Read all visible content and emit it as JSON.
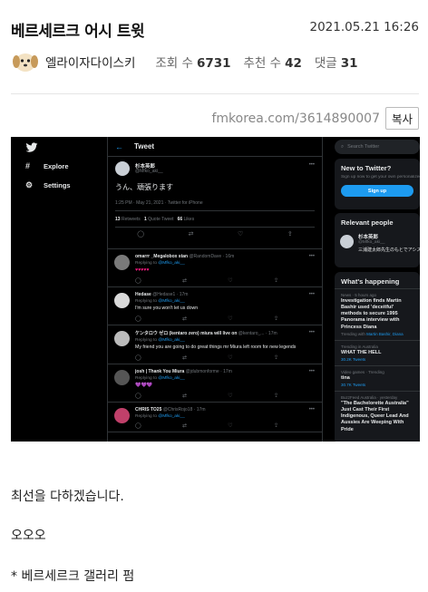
{
  "post": {
    "title": "베르세르크 어시 트윗",
    "date": "2021.05.21 16:26",
    "author": "엘라이자다이스키",
    "stats": [
      {
        "label": "조회 수",
        "value": "6731"
      },
      {
        "label": "추천 수",
        "value": "42"
      },
      {
        "label": "댓글",
        "value": "31"
      }
    ],
    "link": "fmkorea.com/3614890007",
    "copy_label": "복사",
    "body": [
      "최선을 다하겠습니다.",
      "오오오",
      "* 베르세르크 갤러리 펌"
    ]
  },
  "twitter": {
    "nav": {
      "explore": "Explore",
      "settings": "Settings"
    },
    "header": "Tweet",
    "tweet": {
      "name": "杉本英郎",
      "handle": "@Mfko_aki__",
      "text": "うん、頑張ります",
      "meta": "1:25 PM · May 21, 2021 · Twitter for iPhone",
      "retweets": "13",
      "retweets_label": "Retweets",
      "quotes": "1",
      "quotes_label": "Quote Tweet",
      "likes": "66",
      "likes_label": "Likes"
    },
    "replies": [
      {
        "name": "omarrr _Megalobox stan",
        "handle": "@RandomDave · 16m",
        "to": "@Mfko_aki__",
        "text": "♥♥♥♥♥",
        "avatar_color": "#7a7a7a",
        "text_color": "#f91880"
      },
      {
        "name": "Hedase",
        "handle": "@Hedase1 · 17m",
        "to": "@Mfko_aki__",
        "text": "I'm sure you won't let us down",
        "avatar_color": "#d9d9d9",
        "text_color": "#e7e9ea"
      },
      {
        "name": "ケンタロウ ゼロ (kentaro zero) miura will live on",
        "handle": "@kentaro_... · 17m",
        "to": "@Mfko_aki__",
        "text": "My friend you are going to do great things mr Miura left room for new legends",
        "avatar_color": "#bbbbbb",
        "text_color": "#e7e9ea"
      },
      {
        "name": "josh | Thank You Miura",
        "handle": "@jdubmonforme · 17m",
        "to": "@Mfko_aki__",
        "text": "💜💜💜",
        "avatar_color": "#555555",
        "text_color": "#a970ff"
      },
      {
        "name": "CHRIS TO25",
        "handle": "@ChrisRojo18 · 17m",
        "to": "@Mfko_aki__",
        "text": "",
        "avatar_color": "#c0406a",
        "text_color": "#e7e9ea"
      }
    ],
    "sidebar": {
      "search_placeholder": "Search Twitter",
      "new_title": "New to Twitter?",
      "new_sub": "Sign up now to get your own personalized timeline!",
      "signup": "Sign up",
      "relevant_title": "Relevant people",
      "person_name": "杉本英郎",
      "person_handle": "@Mfko_aki__",
      "person_bio": "三浦建太郎先生のもとでアシスタントの仕事をしています。スタジ",
      "happening_title": "What's happening",
      "trends": [
        {
          "cat": "News · 5 hours ago",
          "title": "Investigation finds Martin Bashir used 'deceitful' methods to secure 1995 Panorama interview with Princess Diana",
          "by_label": "Trending with",
          "by": "Martin Bashir, Diana"
        },
        {
          "cat": "Trending in Australia",
          "title": "WHAT THE HELL",
          "by_label": "",
          "by": "30.2K Tweets"
        },
        {
          "cat": "Video games · Trending",
          "title": "tina",
          "by_label": "",
          "by": "30.7K Tweets"
        },
        {
          "cat": "BuzzFeed Australia · yesterday",
          "title": "\"The Bachelorette Australia\" Just Cast Their First Indigenous, Queer Lead And Aussies Are Weeping With Pride",
          "by_label": "",
          "by": ""
        }
      ]
    }
  }
}
